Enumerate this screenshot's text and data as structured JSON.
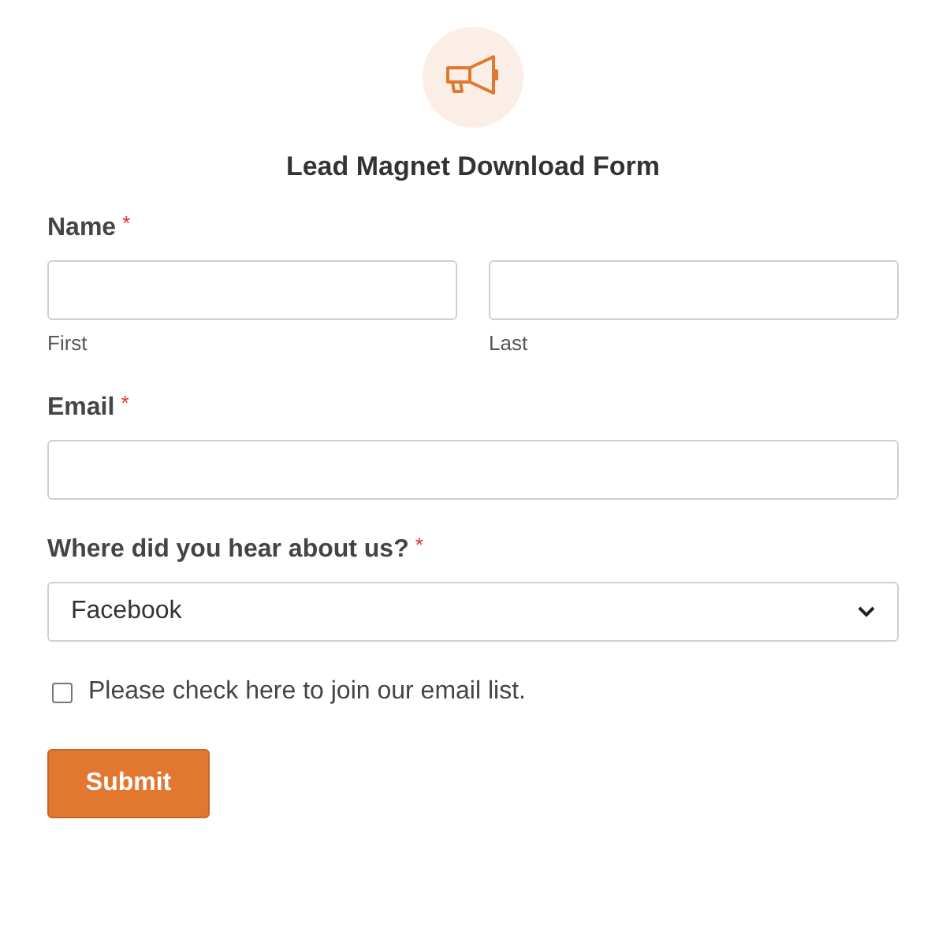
{
  "form": {
    "title": "Lead Magnet Download Form"
  },
  "fields": [
    {
      "kind": "name",
      "label": "Name",
      "required_mark": "*",
      "sublabels": [
        "First",
        "Last"
      ]
    },
    {
      "kind": "text",
      "label": "Email",
      "required_mark": "*"
    },
    {
      "kind": "select",
      "label": "Where did you hear about us?",
      "required_mark": "*",
      "value": "Facebook"
    },
    {
      "kind": "checkbox",
      "label": "Please check here to join our email list.",
      "checked": false
    }
  ],
  "submit": {
    "label": "Submit"
  }
}
